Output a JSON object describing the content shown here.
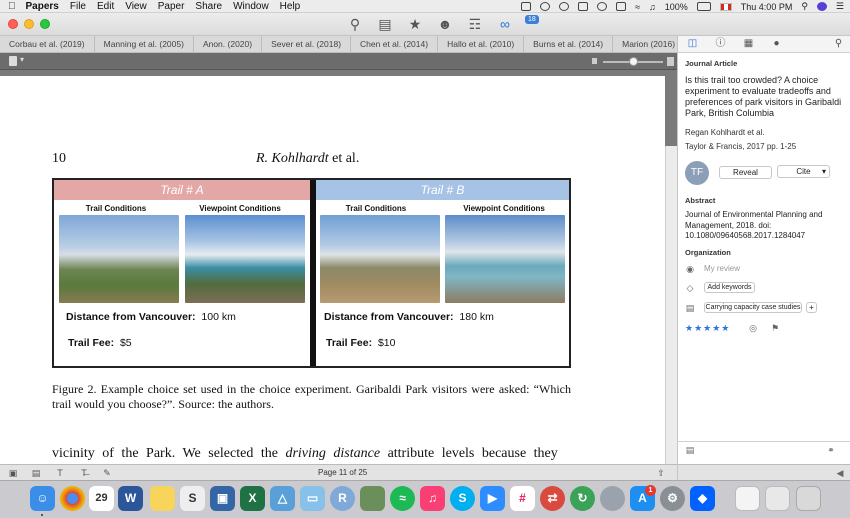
{
  "menubar": {
    "app_name": "Papers",
    "items": [
      "File",
      "Edit",
      "View",
      "Paper",
      "Share",
      "Window",
      "Help"
    ],
    "battery": "100%",
    "clock": "Thu 4:00 PM"
  },
  "toolbar": {
    "badge_count": "18"
  },
  "tabs": [
    "Corbau et al. (2019)",
    "Manning et al. (2005)",
    "Anon. (2020)",
    "Sever et al. (2018)",
    "Chen et al. (2014)",
    "Hallo et al. (2010)",
    "Burns et al. (2014)",
    "Marion (2016)"
  ],
  "tabs_more": "• • •",
  "page": {
    "page_number": "10",
    "author_name": "R. Kohlhardt",
    "author_suffix": " et al.",
    "figure": {
      "trail_a": {
        "title": "Trail # A",
        "left_label": "Trail Conditions",
        "right_label": "Viewpoint Conditions",
        "distance_label": "Distance from Vancouver:",
        "distance_value": "100 km",
        "fee_label": "Trail Fee:",
        "fee_value": "$5"
      },
      "trail_b": {
        "title": "Trail # B",
        "left_label": "Trail Conditions",
        "right_label": "Viewpoint Conditions",
        "distance_label": "Distance from Vancouver:",
        "distance_value": "180 km",
        "fee_label": "Trail Fee:",
        "fee_value": "$10"
      }
    },
    "caption": "Figure 2.   Example choice set used in the choice experiment. Garibaldi Park visitors were asked: “Which trail would you choose?”. Source: the authors.",
    "body_pre": "vicinity of the Park. We selected the ",
    "body_italic": "driving distance",
    "body_post": " attribute levels because they"
  },
  "pdf_bottom": {
    "page_label": "Page 11 of 25"
  },
  "inspector": {
    "type_label": "Journal Article",
    "title": "Is this trail too crowded? A choice experiment to evaluate tradeoffs and preferences of park visitors in Garibaldi Park, British Columbia",
    "author": "Regan Kohlhardt et al.",
    "publisher": "Taylor & Francis, 2017 pp. 1-25",
    "avatar_initials": "TF",
    "reveal_label": "Reveal",
    "cite_label": "Cite",
    "abstract_label": "Abstract",
    "abstract_text": "Journal of Environmental Planning and Management, 2018. doi: 10.1080/09640568.2017.1284047",
    "organization_label": "Organization",
    "review_placeholder": "My review",
    "add_keywords_label": "Add keywords",
    "collection_label": "Carrying capacity case studies",
    "add_collection_label": "+",
    "rating": 5,
    "stars": "★★★★★"
  },
  "dock": {
    "calendar_day": "29",
    "badge": "1"
  },
  "colors": {
    "trail_a_header": "#e3a7a6",
    "trail_b_header": "#a6c3e6",
    "accent": "#2d74d6"
  }
}
